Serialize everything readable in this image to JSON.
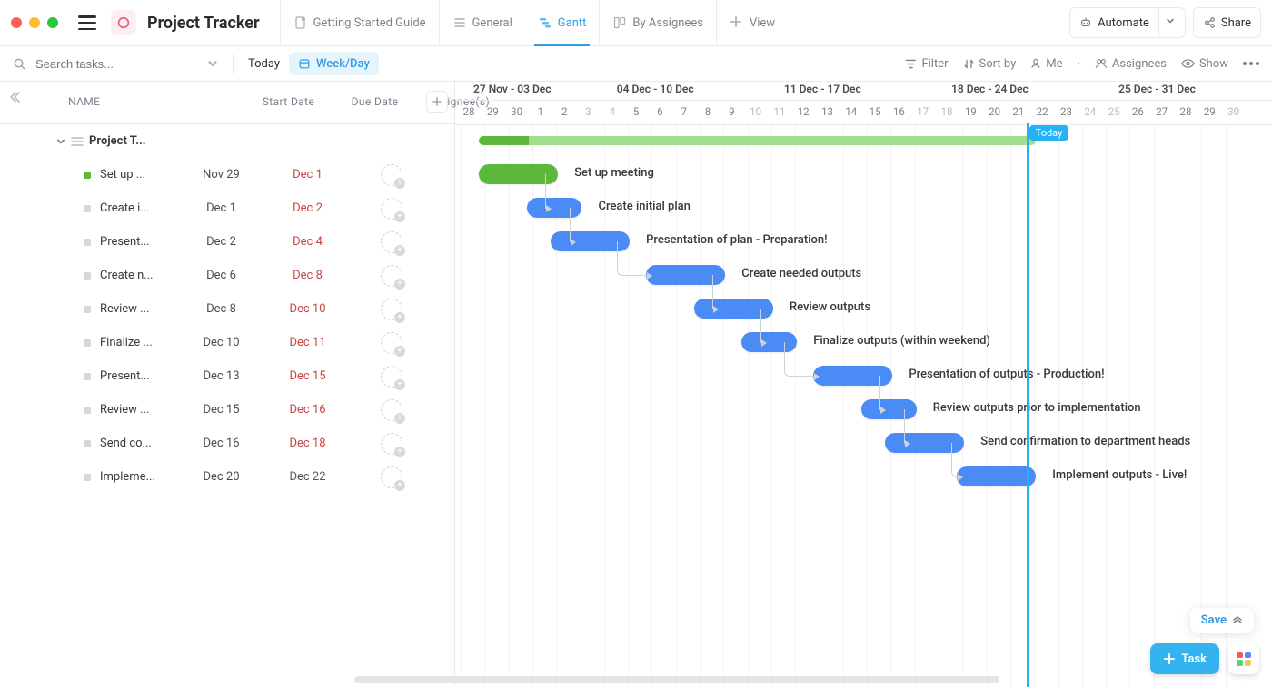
{
  "header": {
    "project_title": "Project Tracker",
    "tabs": [
      {
        "label": "Getting Started Guide",
        "icon": "doc-pin-icon"
      },
      {
        "label": "General",
        "icon": "list-icon"
      },
      {
        "label": "Gantt",
        "icon": "gantt-icon",
        "active": true
      },
      {
        "label": "By Assignees",
        "icon": "board-icon"
      }
    ],
    "add_view_label": "View",
    "automate_label": "Automate",
    "share_label": "Share"
  },
  "toolbar": {
    "search_placeholder": "Search tasks...",
    "today_label": "Today",
    "zoom_label": "Week/Day",
    "filter_label": "Filter",
    "sort_label": "Sort by",
    "me_label": "Me",
    "assignees_label": "Assignees",
    "show_label": "Show"
  },
  "columns": {
    "name": "NAME",
    "start": "Start Date",
    "due": "Due Date",
    "assignee": "Assignee(s)"
  },
  "group": {
    "name": "Project T..."
  },
  "tasks": [
    {
      "name": "Set up ...",
      "full": "Set up meeting",
      "start": "Nov 29",
      "due": "Dec 1",
      "due_red": true,
      "done": true,
      "bar_start": 28,
      "bar_end": 1
    },
    {
      "name": "Create i...",
      "full": "Create initial plan",
      "start": "Dec 1",
      "due": "Dec 2",
      "due_red": true,
      "done": false,
      "bar_start": 30,
      "bar_end": 2
    },
    {
      "name": "Present...",
      "full": "Presentation of plan - Preparation!",
      "start": "Dec 2",
      "due": "Dec 4",
      "due_red": true,
      "done": false,
      "bar_start": 1,
      "bar_end": 4
    },
    {
      "name": "Create n...",
      "full": "Create needed outputs",
      "start": "Dec 6",
      "due": "Dec 8",
      "due_red": true,
      "done": false,
      "bar_start": 5,
      "bar_end": 8
    },
    {
      "name": "Review ...",
      "full": "Review outputs",
      "start": "Dec 8",
      "due": "Dec 10",
      "due_red": true,
      "done": false,
      "bar_start": 7,
      "bar_end": 10
    },
    {
      "name": "Finalize ...",
      "full": "Finalize outputs (within weekend)",
      "start": "Dec 10",
      "due": "Dec 11",
      "due_red": true,
      "done": false,
      "bar_start": 9,
      "bar_end": 11
    },
    {
      "name": "Present...",
      "full": "Presentation of outputs - Production!",
      "start": "Dec 13",
      "due": "Dec 15",
      "due_red": true,
      "done": false,
      "bar_start": 12,
      "bar_end": 15
    },
    {
      "name": "Review ...",
      "full": "Review outputs prior to implementation",
      "start": "Dec 15",
      "due": "Dec 16",
      "due_red": true,
      "done": false,
      "bar_start": 14,
      "bar_end": 16
    },
    {
      "name": "Send co...",
      "full": "Send confirmation to department heads",
      "start": "Dec 16",
      "due": "Dec 18",
      "due_red": true,
      "done": false,
      "bar_start": 15,
      "bar_end": 18
    },
    {
      "name": "Impleme...",
      "full": "Implement outputs - Live!",
      "start": "Dec 20",
      "due": "Dec 22",
      "due_red": false,
      "done": false,
      "bar_start": 18,
      "bar_end": 21
    }
  ],
  "gantt": {
    "week_ranges": [
      "27 Nov - 03 Dec",
      "04 Dec - 10 Dec",
      "11 Dec - 17 Dec",
      "18 Dec - 24 Dec",
      "25 Dec - 31 Dec"
    ],
    "days": [
      28,
      29,
      30,
      1,
      2,
      3,
      4,
      5,
      6,
      7,
      8,
      9,
      10,
      11,
      12,
      13,
      14,
      15,
      16,
      17,
      18,
      19,
      20,
      21,
      22,
      23,
      24,
      25,
      26,
      27,
      28,
      29,
      30
    ],
    "weekend_idx": [
      5,
      6,
      12,
      13,
      19,
      20,
      26,
      27,
      32,
      33
    ],
    "today_label": "Today",
    "today_day": 21,
    "project_bar": {
      "start": 28,
      "end": 21
    }
  },
  "footer": {
    "save_label": "Save",
    "task_label": "Task"
  },
  "chart_data": {
    "type": "gantt",
    "title": "Project Tracker",
    "date_range": {
      "start": "Nov 28",
      "end": "Dec 30"
    },
    "today": "Dec 21",
    "tasks": [
      {
        "name": "Set up meeting",
        "start": "Nov 28",
        "end": "Dec 1",
        "status": "done"
      },
      {
        "name": "Create initial plan",
        "start": "Nov 30",
        "end": "Dec 2",
        "status": "open",
        "depends_on": "Set up meeting"
      },
      {
        "name": "Presentation of plan - Preparation!",
        "start": "Dec 1",
        "end": "Dec 4",
        "status": "open",
        "depends_on": "Create initial plan"
      },
      {
        "name": "Create needed outputs",
        "start": "Dec 5",
        "end": "Dec 8",
        "status": "open",
        "depends_on": "Presentation of plan - Preparation!"
      },
      {
        "name": "Review outputs",
        "start": "Dec 7",
        "end": "Dec 10",
        "status": "open",
        "depends_on": "Create needed outputs"
      },
      {
        "name": "Finalize outputs (within weekend)",
        "start": "Dec 9",
        "end": "Dec 11",
        "status": "open",
        "depends_on": "Review outputs"
      },
      {
        "name": "Presentation of outputs - Production!",
        "start": "Dec 12",
        "end": "Dec 15",
        "status": "open",
        "depends_on": "Finalize outputs (within weekend)"
      },
      {
        "name": "Review outputs prior to implementation",
        "start": "Dec 14",
        "end": "Dec 16",
        "status": "open",
        "depends_on": "Presentation of outputs - Production!"
      },
      {
        "name": "Send confirmation to department heads",
        "start": "Dec 15",
        "end": "Dec 18",
        "status": "open",
        "depends_on": "Review outputs prior to implementation"
      },
      {
        "name": "Implement outputs - Live!",
        "start": "Dec 18",
        "end": "Dec 21",
        "status": "open",
        "depends_on": "Send confirmation to department heads"
      }
    ]
  }
}
